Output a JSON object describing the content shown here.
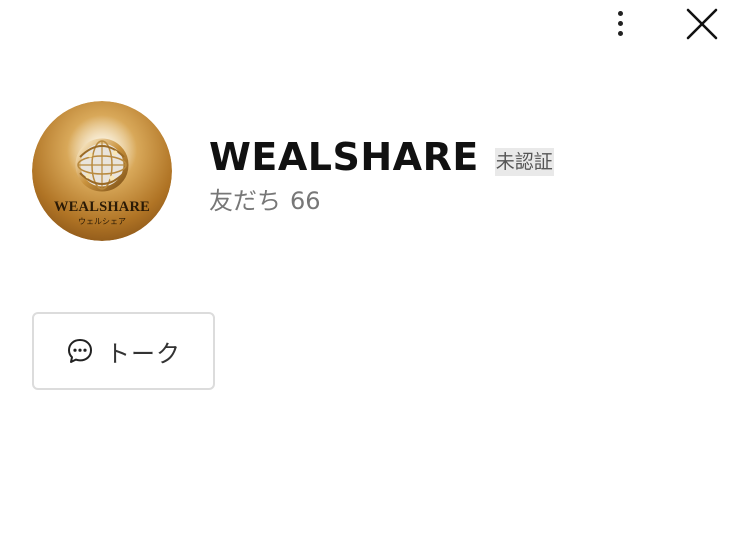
{
  "header": {
    "more_icon": "more-vertical-icon",
    "close_icon": "close-icon"
  },
  "profile": {
    "avatar": {
      "logo_text": "WEALSHARE",
      "logo_subtext": "ウェルシェア",
      "colors": {
        "gold_light": "#f3d9a0",
        "gold_mid": "#c8923a",
        "gold_dark": "#7a4d15"
      }
    },
    "name": "WEALSHARE",
    "verification_badge": "未認証",
    "friends_label": "友だち",
    "friends_count": "66"
  },
  "actions": {
    "talk_label": "トーク",
    "talk_icon": "chat-bubble-icon"
  }
}
